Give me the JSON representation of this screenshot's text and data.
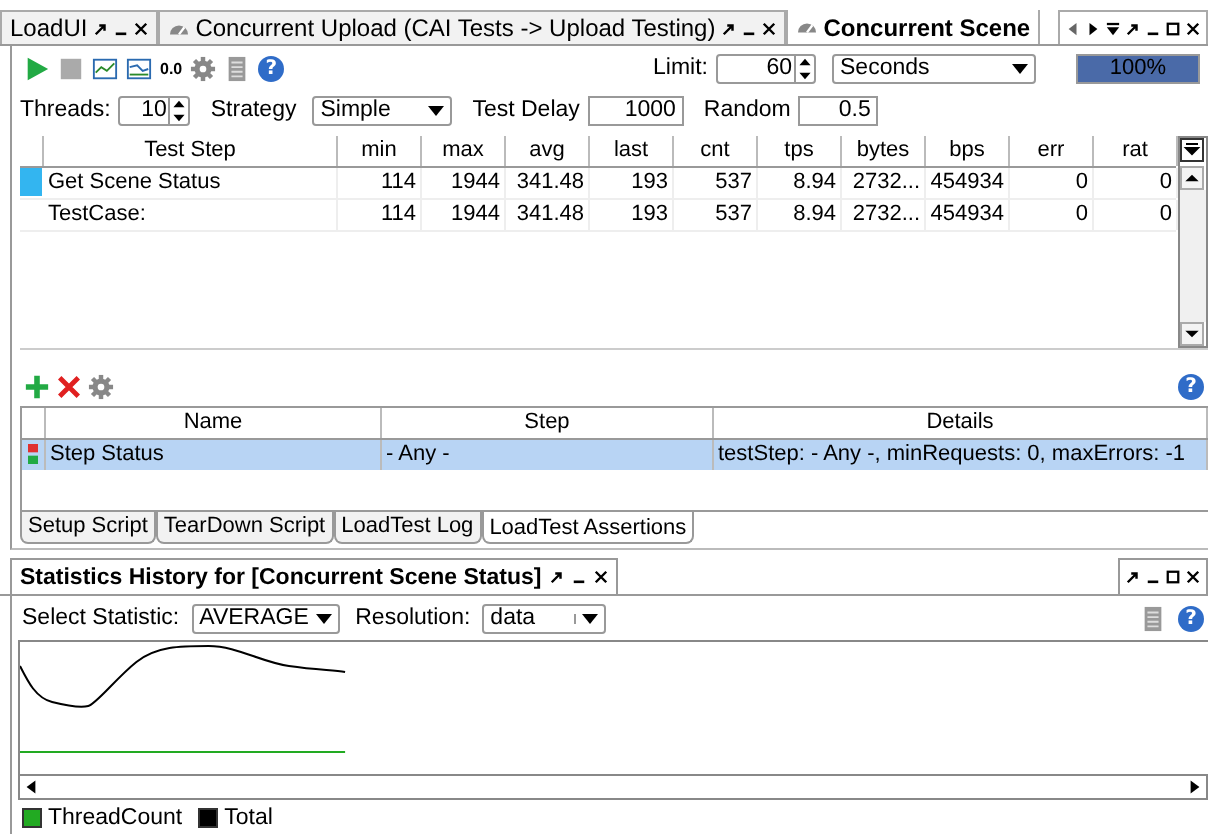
{
  "tabs": [
    {
      "label": "LoadUI",
      "kind": "plain",
      "selected": false
    },
    {
      "label": "Concurrent Upload (CAI Tests -> Upload Testing)",
      "kind": "loadtest",
      "selected": false
    },
    {
      "label": "Concurrent Scene",
      "kind": "loadtest",
      "selected": true
    }
  ],
  "toolbar": {
    "decimal_label": "0.0",
    "help": "?",
    "limit_label": "Limit:",
    "limit_value": "60",
    "unit": "Seconds",
    "progress": {
      "text": "100%",
      "level": 1
    }
  },
  "settings": {
    "threads_label": "Threads:",
    "threads": "10",
    "strategy_label": "Strategy",
    "strategy": "Simple",
    "delay_label": "Test Delay",
    "delay": "1000",
    "random_label": "Random",
    "random": "0.5"
  },
  "steps_table": {
    "columns": [
      "Test Step",
      "min",
      "max",
      "avg",
      "last",
      "cnt",
      "tps",
      "bytes",
      "bps",
      "err",
      "rat"
    ],
    "rows": [
      {
        "color": "#33b5f0",
        "cells": [
          "Get Scene Status",
          "114",
          "1944",
          "341.48",
          "193",
          "537",
          "8.94",
          "2732...",
          "454934",
          "0",
          "0"
        ]
      },
      {
        "cells": [
          "TestCase:",
          "114",
          "1944",
          "341.48",
          "193",
          "537",
          "8.94",
          "2732...",
          "454934",
          "0",
          "0"
        ]
      }
    ]
  },
  "assertions": {
    "help": "?",
    "columns": [
      "Name",
      "Step",
      "Details"
    ],
    "rows": [
      {
        "selected": true,
        "name": "Step Status",
        "step": "- Any -",
        "details": "testStep: - Any -, minRequests: 0, maxErrors: -1"
      }
    ]
  },
  "subtabs": [
    {
      "label": "Setup Script",
      "selected": false
    },
    {
      "label": "TearDown Script",
      "selected": false
    },
    {
      "label": "LoadTest Log",
      "selected": false
    },
    {
      "label": "LoadTest Assertions",
      "selected": true
    }
  ],
  "history": {
    "title": "Statistics History for [Concurrent Scene Status]",
    "statistic_label": "Select Statistic:",
    "statistic": "AVERAGE",
    "resolution_label": "Resolution:",
    "resolution": "data",
    "help": "?",
    "legend": [
      {
        "label": "ThreadCount",
        "color": "#22aa22"
      },
      {
        "label": "Total",
        "color": "#000000"
      }
    ]
  }
}
